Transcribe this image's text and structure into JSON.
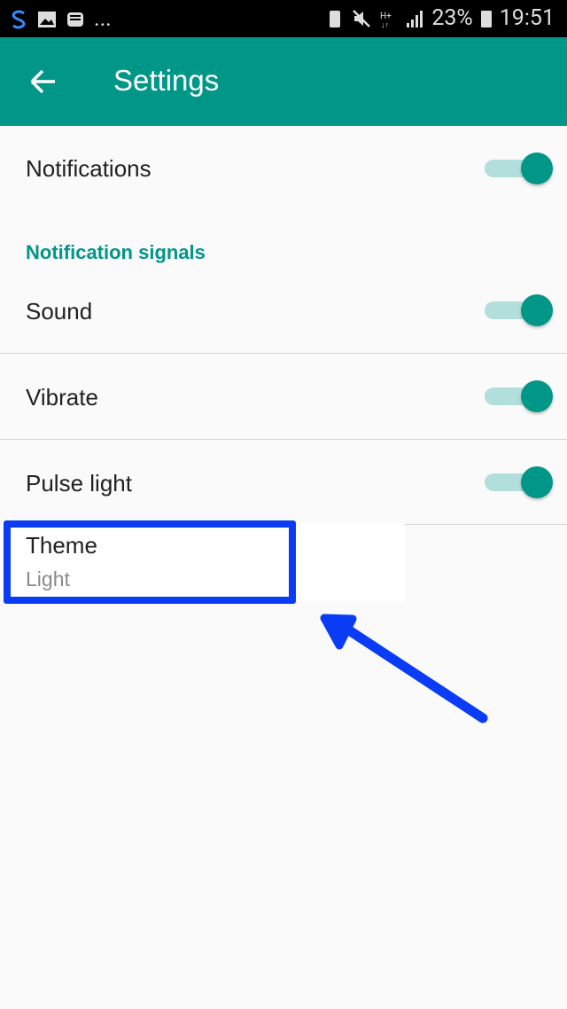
{
  "status_bar": {
    "left_icons": [
      "s-app-icon",
      "gallery-icon",
      "inbox-icon"
    ],
    "more": "...",
    "right_icons": [
      "battery-saver-icon",
      "mute-icon",
      "hplus-data-icon",
      "signal-icon"
    ],
    "battery": "23%",
    "time": "19:51"
  },
  "app_bar": {
    "title": "Settings",
    "back_icon": "arrow-left-icon",
    "color": "#009688"
  },
  "settings": {
    "notifications": {
      "label": "Notifications",
      "enabled": true
    },
    "section_header": "Notification signals",
    "sound": {
      "label": "Sound",
      "enabled": true
    },
    "vibrate": {
      "label": "Vibrate",
      "enabled": true
    },
    "pulse_light": {
      "label": "Pulse light",
      "enabled": true
    },
    "theme": {
      "label": "Theme",
      "value": "Light"
    }
  },
  "annotation": {
    "color": "#0a3cf5"
  }
}
